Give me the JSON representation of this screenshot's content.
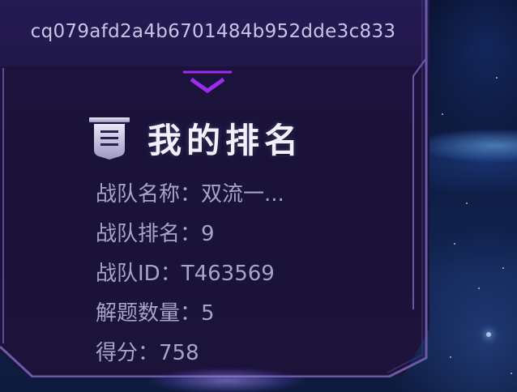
{
  "header": {
    "clipped_text": "· ·· ·· ·",
    "hash": "cq079afd2a4b6701484b952dde3c833"
  },
  "section": {
    "title": "我的排名",
    "icon": "list-icon",
    "divider_icon": "chevron-down-icon"
  },
  "rank": {
    "team_name_label": "战队名称：",
    "team_name_value": "双流一...",
    "team_rank_label": "战队排名：",
    "team_rank_value": "9",
    "team_id_label": "战队ID：",
    "team_id_value": "T463569",
    "solved_label": "解题数量：",
    "solved_value": "5",
    "score_label": "得分：",
    "score_value": "758"
  },
  "colors": {
    "panel_bg": "#1b1339",
    "accent_purple": "#8a2be2",
    "text_muted": "#a8a3c9",
    "title_text": "#f2f0ff"
  }
}
